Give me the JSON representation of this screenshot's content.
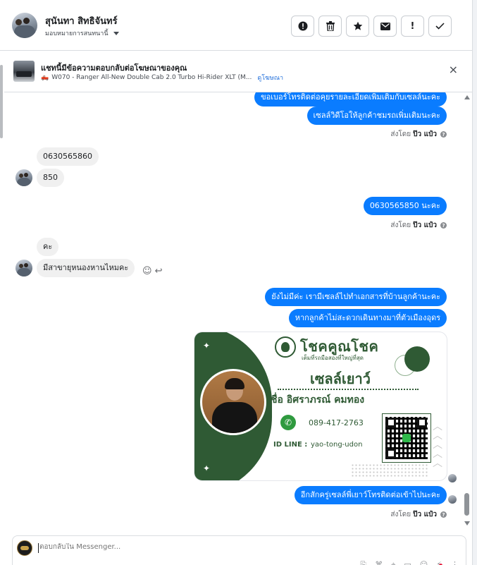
{
  "header": {
    "contact_name": "สุนันทา สิทธิจันทร์",
    "assign_label": "มอบหมายการสนทนานี้",
    "actions": [
      {
        "icon": "alert-circle-icon",
        "glyph": "!"
      },
      {
        "icon": "trash-icon",
        "glyph": "🗑"
      },
      {
        "icon": "star-icon",
        "glyph": "★"
      },
      {
        "icon": "envelope-icon",
        "glyph": "✉"
      },
      {
        "icon": "exclamation-icon",
        "glyph": "!"
      },
      {
        "icon": "check-icon",
        "glyph": "✓"
      }
    ]
  },
  "ad_bar": {
    "title": "แชทนี้มีข้อความตอบกลับต่อโฆษณาของคุณ",
    "product": "W070 - Ranger All-New Double Cab 2.0 Turbo Hi-Rider XLT (M...",
    "view_ad": "ดูโฆษณา",
    "close_glyph": "×"
  },
  "thread": {
    "out_top_partial": "ขอเบอร์โทรติดต่อคุยรายละเอียดเพิ่มเติมกับเซลล์นะคะ",
    "out_video": "เซลล์วิดีโอให้ลูกค้าชมรถเพิ่มเติมนะคะ",
    "sent_by_prefix": "ส่งโดย",
    "sent_by_name": "ป๊ว แป๋ว",
    "info_glyph": "?",
    "in_phone": "0630565860",
    "in_850": "850",
    "out_phone": "0630565850   นะคะ",
    "in_ka": "คะ",
    "in_question": "มีสาขายุหนองหานไหมคะ",
    "out_no_branch": "ยังไม่มีค่ะ เรามีเซลล์ไปทำเอกสารที่บ้านลูกค้านะคะ",
    "out_if_inconvenient": "หากลูกค้าไม่สะดวกเดินทางมาที่ตัวเมืองอุดร",
    "out_sales_call": "อีกสักครู่เซลล์พี่เยาว์โทรติดต่อเข้าไปนะคะ"
  },
  "business_card": {
    "brand": "โชคคูณโชค",
    "tagline": "เต็มที่รถมือสองที่ใหญ่ที่สุด",
    "nickname": "เซลล์เยาว์",
    "fullname": "ชื่อ อิศราภรณ์  คมทอง",
    "phone": "089-417-2763",
    "line_label": "ID LINE :",
    "line_id": "yao-tong-udon"
  },
  "composer": {
    "placeholder": "ตอบกลับใน Messenger..."
  },
  "colors": {
    "outgoing_bubble": "#0a7cff",
    "incoming_bubble": "#f0f0f0",
    "card_green": "#2f5a34"
  }
}
